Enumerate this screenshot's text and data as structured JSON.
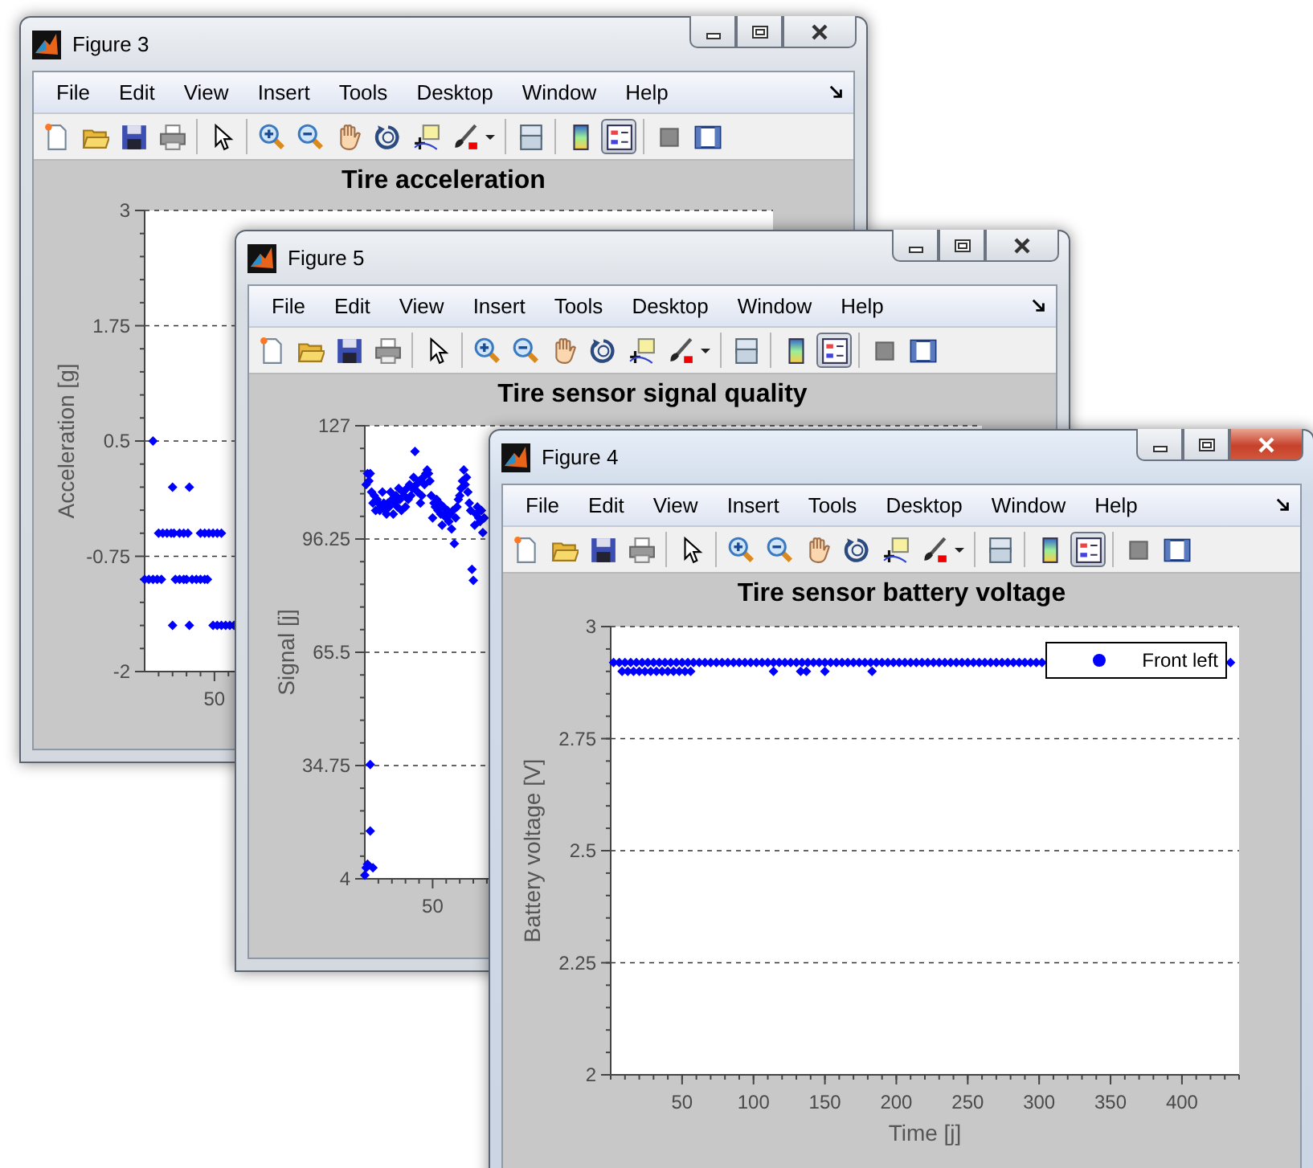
{
  "windows": [
    {
      "title": "Figure 3",
      "active": false,
      "menu": [
        "File",
        "Edit",
        "View",
        "Insert",
        "Tools",
        "Desktop",
        "Window",
        "Help"
      ],
      "legend_toggle": {
        "selected": true
      },
      "plot": {
        "title": "Tire acceleration",
        "ylabel": "Acceleration [g]",
        "y_tick_labels": [
          "3",
          "1.75",
          "0.5",
          "-0.75",
          "-2"
        ],
        "x_tick_labels": [
          "50"
        ]
      }
    },
    {
      "title": "Figure 5",
      "active": false,
      "menu": [
        "File",
        "Edit",
        "View",
        "Insert",
        "Tools",
        "Desktop",
        "Window",
        "Help"
      ],
      "legend_toggle": {
        "selected": true
      },
      "plot": {
        "title": "Tire sensor signal quality",
        "ylabel": "Signal [j]",
        "y_tick_labels": [
          "127",
          "96.25",
          "65.5",
          "34.75",
          "4"
        ],
        "x_tick_labels": [
          "50"
        ]
      }
    },
    {
      "title": "Figure 4",
      "active": true,
      "menu": [
        "File",
        "Edit",
        "View",
        "Insert",
        "Tools",
        "Desktop",
        "Window",
        "Help"
      ],
      "legend_toggle": {
        "selected": true
      },
      "chart_data": {
        "type": "scatter",
        "title": "Tire sensor battery voltage",
        "xlabel": "Time [j]",
        "ylabel": "Battery voltage [V]",
        "grid": true,
        "xlim": [
          0,
          440
        ],
        "ylim": [
          2,
          3
        ],
        "xticks": [
          50,
          100,
          150,
          200,
          250,
          300,
          350,
          400
        ],
        "yticks": [
          3,
          2.75,
          2.5,
          2.25,
          2
        ],
        "x": [
          2,
          6,
          10,
          14,
          18,
          22,
          26,
          30,
          34,
          38,
          42,
          46,
          50,
          54,
          58,
          62,
          66,
          70,
          74,
          78,
          82,
          86,
          90,
          94,
          98,
          102,
          106,
          110,
          114,
          118,
          122,
          126,
          130,
          134,
          138,
          142,
          146,
          150,
          154,
          158,
          162,
          166,
          170,
          174,
          178,
          182,
          186,
          190,
          194,
          198,
          202,
          206,
          210,
          214,
          218,
          222,
          226,
          230,
          234,
          238,
          242,
          246,
          250,
          254,
          258,
          262,
          266,
          270,
          274,
          278,
          282,
          286,
          290,
          294,
          298,
          302,
          434,
          8,
          12,
          16,
          20,
          24,
          28,
          32,
          36,
          40,
          44,
          48,
          52,
          56,
          114,
          133,
          137,
          150,
          183
        ],
        "series": [
          {
            "name": "Front left",
            "color": "#0000ff",
            "values": [
              2.92,
              2.92,
              2.92,
              2.92,
              2.92,
              2.92,
              2.92,
              2.92,
              2.92,
              2.92,
              2.92,
              2.92,
              2.92,
              2.92,
              2.92,
              2.92,
              2.92,
              2.92,
              2.92,
              2.92,
              2.92,
              2.92,
              2.92,
              2.92,
              2.92,
              2.92,
              2.92,
              2.92,
              2.92,
              2.92,
              2.92,
              2.92,
              2.92,
              2.92,
              2.92,
              2.92,
              2.92,
              2.92,
              2.92,
              2.92,
              2.92,
              2.92,
              2.92,
              2.92,
              2.92,
              2.92,
              2.92,
              2.92,
              2.92,
              2.92,
              2.92,
              2.92,
              2.92,
              2.92,
              2.92,
              2.92,
              2.92,
              2.92,
              2.92,
              2.92,
              2.92,
              2.92,
              2.92,
              2.92,
              2.92,
              2.92,
              2.92,
              2.92,
              2.92,
              2.92,
              2.92,
              2.92,
              2.92,
              2.92,
              2.92,
              2.92,
              2.92,
              2.9,
              2.9,
              2.9,
              2.9,
              2.9,
              2.9,
              2.9,
              2.9,
              2.9,
              2.9,
              2.9,
              2.9,
              2.9,
              2.9,
              2.9,
              2.9,
              2.9,
              2.9
            ]
          }
        ]
      }
    }
  ]
}
